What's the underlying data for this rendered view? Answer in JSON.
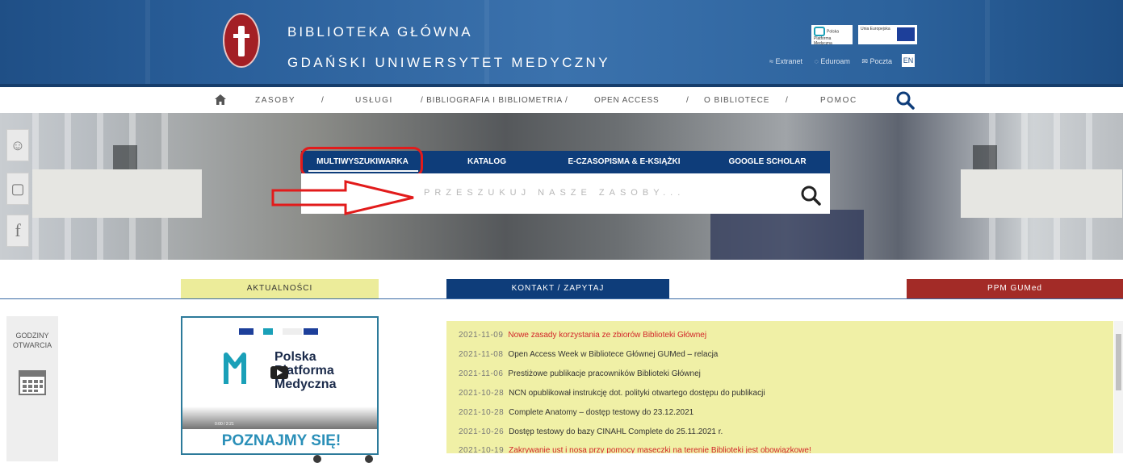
{
  "header": {
    "title_line1": "BIBLIOTEKA GŁÓWNA",
    "title_line2": "GDAŃSKI UNIWERSYTET MEDYCZNY",
    "partner1": "Polska Platforma Medyczna",
    "partner2": "Unia Europejska",
    "links": [
      "Extranet",
      "Eduroam",
      "Poczta"
    ],
    "lang": "EN",
    "colors": {
      "header_bg": "#2a5f9a",
      "logo_red": "#a31f25"
    }
  },
  "nav": {
    "items": [
      "ZASOBY",
      "/",
      "USŁUGI",
      "/ BIBLIOGRAFIA I BIBLIOMETRIA /",
      "OPEN ACCESS",
      "/",
      "O BIBLIOTECE",
      "/",
      "POMOC"
    ],
    "icons": [
      "home-icon",
      "search-icon"
    ]
  },
  "social": {
    "icons": [
      "user-login-icon",
      "instagram-icon",
      "facebook-icon"
    ]
  },
  "search": {
    "tabs": [
      "MULTIWYSZUKIWARKA",
      "KATALOG",
      "E-CZASOPISMA & E-KSIĄŻKI",
      "GOOGLE SCHOLAR"
    ],
    "active_tab": "MULTIWYSZUKIWARKA",
    "placeholder": "PRZESZUKUJ NASZE ZASOBY...",
    "colors": {
      "tab_bg": "#0e3d7a",
      "highlight": "#e21b1b"
    }
  },
  "sections": {
    "aktualnosci": "AKTUALNOŚCI",
    "kontakt": "KONTAKT / ZAPYTAJ",
    "ppm": "PPM GUMed"
  },
  "godziny": {
    "line1": "GODZINY",
    "line2": "OTWARCIA",
    "icon": "calendar-icon"
  },
  "video": {
    "brand_line1": "Polska",
    "brand_line2": "Platforma",
    "brand_line3": "Medyczna",
    "time": "0:00 / 2:21",
    "caption": "POZNAJMY SIĘ!"
  },
  "news": [
    {
      "date": "2021-11-09",
      "title": "Nowe zasady korzystania ze zbiorów Biblioteki Głównej",
      "highlight": true
    },
    {
      "date": "2021-11-08",
      "title": "Open Access Week w Bibliotece Głównej GUMed – relacja",
      "highlight": false
    },
    {
      "date": "2021-11-06",
      "title": "Prestiżowe publikacje pracowników Biblioteki Głównej",
      "highlight": false
    },
    {
      "date": "2021-10-28",
      "title": "NCN opublikował instrukcję dot. polityki otwartego dostępu do publikacji",
      "highlight": false
    },
    {
      "date": "2021-10-28",
      "title": "Complete Anatomy – dostęp testowy do 23.12.2021",
      "highlight": false
    },
    {
      "date": "2021-10-26",
      "title": "Dostęp testowy do bazy CINAHL Complete do 25.11.2021 r.",
      "highlight": false
    },
    {
      "date": "2021-10-19",
      "title": "Zakrywanie ust i nosa przy pomocy maseczki na terenie Biblioteki jest obowiązkowe!",
      "highlight": true
    }
  ]
}
